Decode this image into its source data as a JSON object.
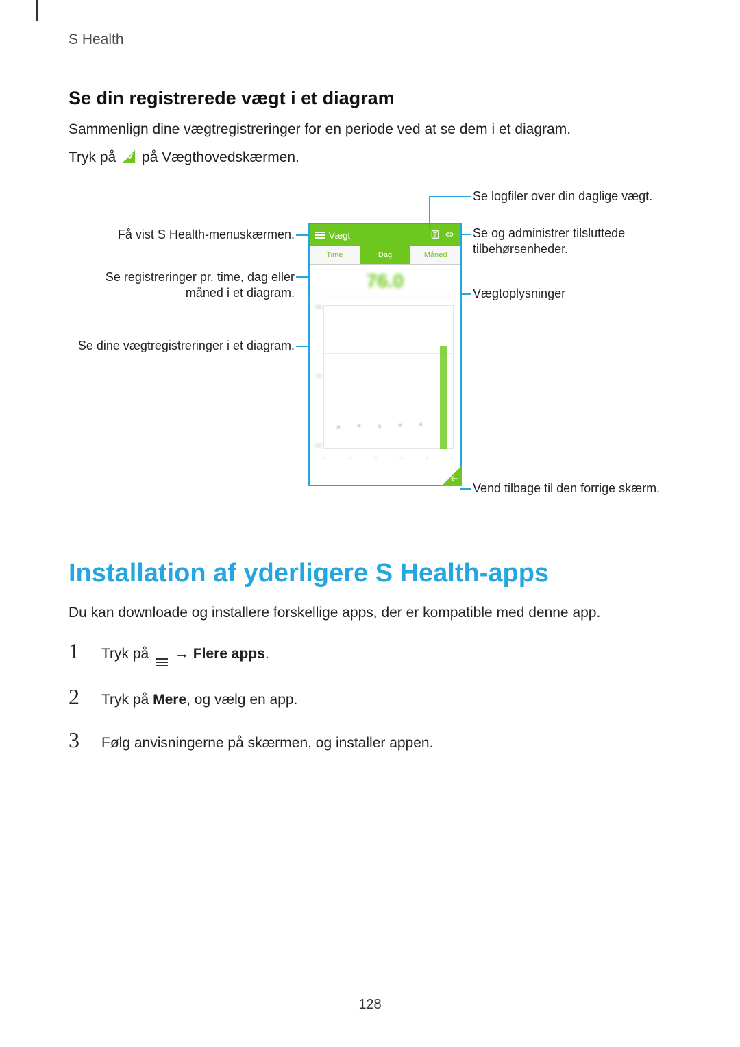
{
  "header": {
    "app_name": "S Health"
  },
  "section1": {
    "title": "Se din registrerede vægt i et diagram",
    "intro": "Sammenlign dine vægtregistreringer for en periode ved at se dem i et diagram.",
    "instruction_pre": "Tryk på ",
    "instruction_post": " på Vægthovedskærmen."
  },
  "diagram": {
    "phone_title": "Vægt",
    "tabs": [
      "Time",
      "Dag",
      "Måned"
    ],
    "active_tab_index": 1,
    "weight_value": "76.0",
    "callouts": {
      "menu": "Få vist S Health-menuskærmen.",
      "tabs": "Se registreringer pr. time, dag eller måned i et diagram.",
      "chart": "Se dine vægtregistreringer i et diagram.",
      "log": "Se logfiler over din daglige vægt.",
      "accessory": "Se og administrer tilsluttede tilbehørsenheder.",
      "weight": "Vægtoplysninger",
      "back": "Vend tilbage til den forrige skærm."
    }
  },
  "section2": {
    "heading": "Installation af yderligere S Health-apps",
    "intro": "Du kan downloade og installere forskellige apps, der er kompatible med denne app.",
    "steps": [
      {
        "num": "1",
        "pre": "Tryk på ",
        "arrow": "→",
        "bold": "Flere apps",
        "suffix": "."
      },
      {
        "num": "2",
        "pre": "Tryk på ",
        "bold": "Mere",
        "post": ", og vælg en app."
      },
      {
        "num": "3",
        "text": "Følg anvisningerne på skærmen, og installer appen."
      }
    ]
  },
  "page_number": "128"
}
